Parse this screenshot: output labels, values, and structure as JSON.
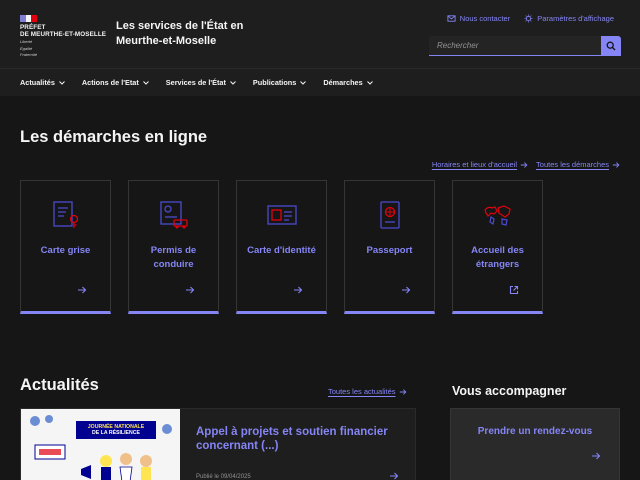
{
  "header": {
    "prefet_line1": "PRÉFET",
    "prefet_line2": "DE MEURTHE-ET-MOSELLE",
    "motto_1": "Liberté",
    "motto_2": "Égalité",
    "motto_3": "Fraternité",
    "site_title": "Les services de l'État en Meurthe-et-Moselle",
    "contact_label": "Nous contacter",
    "display_label": "Paramètres d'affichage",
    "search_placeholder": "Rechercher"
  },
  "nav": {
    "items": [
      "Actualités",
      "Actions de l'Etat",
      "Services de l'État",
      "Publications",
      "Démarches"
    ]
  },
  "demarches": {
    "title": "Les démarches en ligne",
    "link_horaires": "Horaires et lieux d'accueil",
    "link_toutes": "Toutes les démarches",
    "cards": [
      {
        "label": "Carte grise",
        "icon": "car-registration-icon",
        "arrow": "arrow-right-icon"
      },
      {
        "label": "Permis de conduire",
        "icon": "driving-license-icon",
        "arrow": "arrow-right-icon"
      },
      {
        "label": "Carte d'identité",
        "icon": "id-card-icon",
        "arrow": "arrow-right-icon"
      },
      {
        "label": "Passeport",
        "icon": "passport-icon",
        "arrow": "arrow-right-icon"
      },
      {
        "label": "Accueil des étrangers",
        "icon": "world-map-icon",
        "arrow": "external-link-icon"
      }
    ]
  },
  "actualites": {
    "title": "Actualités",
    "link_toutes": "Toutes les actualités",
    "news": {
      "image_banner_1": "JOURNÉE NATIONALE",
      "image_banner_2": "DE LA RÉSILIENCE",
      "title": "Appel à projets et soutien financier concernant (...)",
      "date": "Publié le 09/04/2025"
    }
  },
  "accompagner": {
    "title": "Vous accompagner",
    "card_label": "Prendre un rendez-vous"
  },
  "colors": {
    "accent": "#8585f6",
    "background": "#161616",
    "header_bg": "#1e1e1e",
    "icon_red": "#e1000f"
  }
}
